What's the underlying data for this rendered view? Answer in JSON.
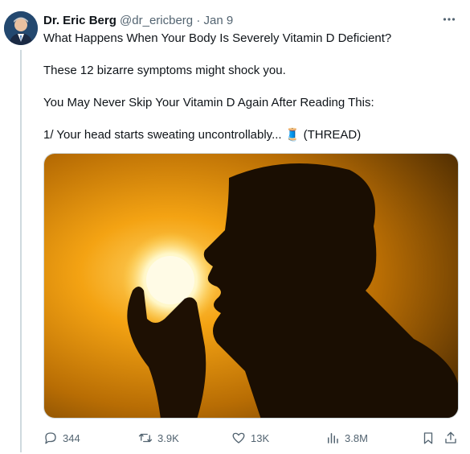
{
  "tweet": {
    "author_name": "Dr. Eric Berg",
    "handle": "@dr_ericberg",
    "separator": "·",
    "date": "Jan 9",
    "lines": [
      "What Happens When Your Body Is Severely Vitamin D Deficient?",
      "These 12 bizarre symptoms might shock you.",
      "You May Never Skip Your Vitamin D Again After Reading This:",
      "1/ Your head starts sweating uncontrollably... 🧵 (THREAD)"
    ]
  },
  "actions": {
    "replies": "344",
    "reposts": "3.9K",
    "likes": "13K",
    "views": "3.8M"
  },
  "icons": {
    "more": "more-icon",
    "reply": "reply-icon",
    "repost": "repost-icon",
    "like": "heart-icon",
    "views": "views-icon",
    "bookmark": "bookmark-icon",
    "share": "share-icon"
  },
  "colors": {
    "text": "#0f1419",
    "secondary": "#536471",
    "border": "#cfd9de"
  }
}
